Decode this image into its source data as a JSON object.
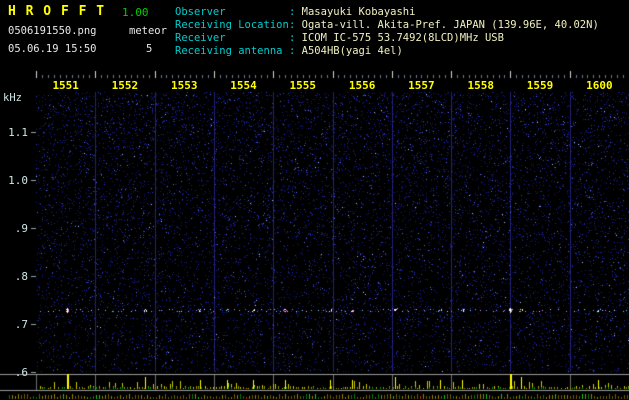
{
  "app": {
    "logo": "H R O F F T",
    "version": "1.00"
  },
  "capture": {
    "filename": "0506191550.png",
    "mode": "meteor",
    "count": "5",
    "datetime": "05.06.19 15:50"
  },
  "station": {
    "separator": ": ",
    "rows": [
      {
        "label": "Observer",
        "value": "Masayuki Kobayashi"
      },
      {
        "label": "Receiving Location",
        "value": "Ogata-vill. Akita-Pref. JAPAN (139.96E, 40.02N)"
      },
      {
        "label": "Receiver",
        "value": "ICOM IC-575 53.7492(8LCD)MHz USB"
      },
      {
        "label": "Receiving antenna",
        "value": "A504HB(yagi 4el)"
      }
    ]
  },
  "spectrogram": {
    "unit": "kHz",
    "freq_ticks": [
      {
        "label": "1.1",
        "kHz": 1.1
      },
      {
        "label": "1.0",
        "kHz": 1.0
      },
      {
        "label": ".9",
        "kHz": 0.9
      },
      {
        "label": ".8",
        "kHz": 0.8
      },
      {
        "label": ".7",
        "kHz": 0.7
      },
      {
        "label": ".6",
        "kHz": 0.6
      }
    ],
    "time_labels": [
      "1551",
      "1552",
      "1553",
      "1554",
      "1555",
      "1556",
      "1557",
      "1558",
      "1559",
      "1600"
    ],
    "band_kHz": 0.73,
    "echoes": [
      {
        "t": 0.052,
        "strength": 3
      },
      {
        "t": 0.184,
        "strength": 2
      },
      {
        "t": 0.277,
        "strength": 1
      },
      {
        "t": 0.322,
        "strength": 1
      },
      {
        "t": 0.366,
        "strength": 1
      },
      {
        "t": 0.42,
        "strength": 1
      },
      {
        "t": 0.496,
        "strength": 1
      },
      {
        "t": 0.533,
        "strength": 1
      },
      {
        "t": 0.605,
        "strength": 2
      },
      {
        "t": 0.681,
        "strength": 1
      },
      {
        "t": 0.718,
        "strength": 1
      },
      {
        "t": 0.799,
        "strength": 3
      },
      {
        "t": 0.818,
        "strength": 2
      },
      {
        "t": 0.948,
        "strength": 1
      }
    ]
  },
  "colors": {
    "background": "#000000",
    "logo_yellow": "#ffff00",
    "version_green": "#00cc00",
    "header_text": "#e8e8e8",
    "info_label_cyan": "#00cccc",
    "info_value": "#f0f0c0",
    "time_label_yellow": "#ffff00",
    "freq_label": "#cfe6e6",
    "grid_blue": "#232378",
    "rule_gray": "#9a9a9a",
    "spike_yellow": "#c8c800",
    "spike_bright": "#ffff00",
    "meter_green": "#00aa00"
  }
}
